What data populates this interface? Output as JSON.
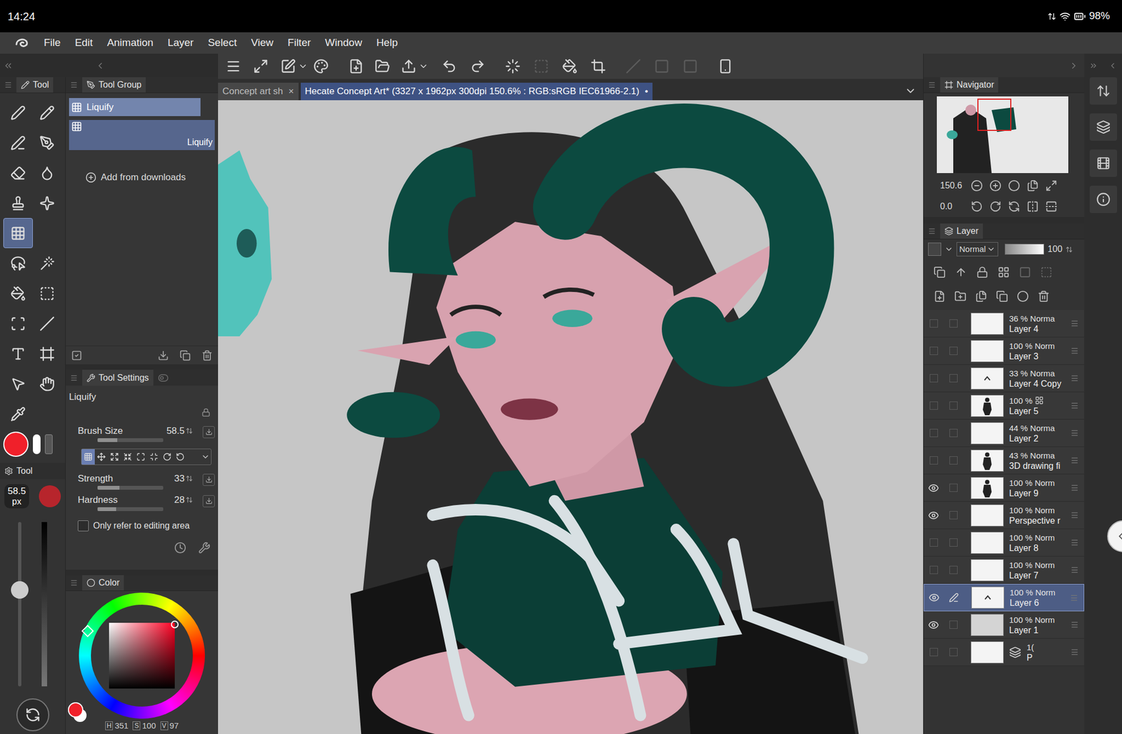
{
  "status_bar": {
    "time": "14:24",
    "battery": "98%"
  },
  "menu": [
    "File",
    "Edit",
    "Animation",
    "Layer",
    "Select",
    "View",
    "Filter",
    "Window",
    "Help"
  ],
  "toolbar": [
    {
      "disabled": false
    },
    {
      "disabled": false
    },
    {
      "disabled": false
    },
    {
      "disabled": false
    },
    {
      "disabled": false
    },
    {
      "disabled": false
    },
    {
      "disabled": false
    },
    {
      "disabled": false
    },
    {
      "disabled": false
    },
    {
      "disabled": false
    },
    {
      "disabled": false
    },
    {
      "disabled": false
    },
    {
      "disabled": true
    },
    {
      "disabled": false
    },
    {
      "disabled": false
    },
    {
      "disabled": true
    },
    {
      "disabled": true
    },
    {
      "disabled": true
    },
    {
      "disabled": false
    }
  ],
  "tabs": [
    {
      "label": "Concept art sh",
      "close": "×",
      "selected": false
    },
    {
      "label": "Hecate Concept Art* (3327 x 1962px 300dpi 150.6% : RGB:sRGB IEC61966-2.1)",
      "close": "•",
      "selected": true
    }
  ],
  "tool_panel": {
    "title": "Tool",
    "tools": [
      {
        "selected": false
      },
      {
        "selected": false
      },
      {
        "selected": false
      },
      {
        "selected": false
      },
      {
        "selected": false
      },
      {
        "selected": false
      },
      {
        "selected": false
      },
      {
        "selected": false
      },
      {
        "selected": true
      },
      {
        "selected": false
      },
      {
        "selected": false
      },
      {
        "selected": false
      },
      {
        "selected": false
      },
      {
        "selected": false
      },
      {
        "selected": false
      },
      {
        "selected": false
      },
      {
        "selected": false
      },
      {
        "selected": false
      },
      {
        "selected": false
      },
      {
        "selected": false
      }
    ],
    "main_color": "#f0202a",
    "sub_title": "Tool",
    "size": "58.5",
    "unit": "px",
    "size_level": 0.64,
    "opacity_level": 1
  },
  "tool_group": {
    "title": "Tool Group",
    "items": [
      {
        "kind": "group",
        "label": "Liquify",
        "selected": true
      },
      {
        "kind": "subtool",
        "label": "Liquify",
        "selected": true
      }
    ],
    "add": "Add from downloads"
  },
  "tool_settings": {
    "title": "Tool Settings",
    "tool": "Liquify",
    "sliders": [
      {
        "label": "Brush Size",
        "value": "58.5",
        "level": 0.3
      },
      {
        "label": "Strength",
        "value": "33",
        "level": 0.33
      },
      {
        "label": "Hardness",
        "value": "28",
        "level": 0.28
      }
    ],
    "modes": [
      {
        "selected": true
      },
      {
        "selected": false
      },
      {
        "selected": false
      },
      {
        "selected": false
      },
      {
        "selected": false
      },
      {
        "selected": false
      },
      {
        "selected": false
      },
      {
        "selected": false
      }
    ],
    "option": {
      "label": "Only refer to editing area",
      "checked": false
    }
  },
  "color_panel": {
    "title": "Color",
    "readings": [
      {
        "label": "H",
        "value": "351"
      },
      {
        "label": "S",
        "value": "100"
      },
      {
        "label": "V",
        "value": "97"
      }
    ]
  },
  "navigator": {
    "title": "Navigator",
    "zoom": "150.6",
    "rotation": "0.0"
  },
  "layer_panel": {
    "title": "Layer",
    "blend": "Normal",
    "opacity": "100",
    "opacity_level": 1,
    "layers": [
      {
        "info": "36 % Norma",
        "name": "Layer 4",
        "visible": false,
        "editing": false,
        "selected": false,
        "thumb": "empty",
        "mask": false
      },
      {
        "info": "100 % Norm",
        "name": "Layer 3",
        "visible": false,
        "editing": false,
        "selected": false,
        "thumb": "empty",
        "mask": false
      },
      {
        "info": "33 % Norma",
        "name": "Layer 4 Copy",
        "visible": false,
        "editing": false,
        "selected": false,
        "thumb": "mark",
        "mask": false
      },
      {
        "info": "100 %",
        "name": "Layer 5",
        "visible": false,
        "editing": false,
        "selected": false,
        "thumb": "figure",
        "mask": true
      },
      {
        "info": "44 % Norma",
        "name": "Layer 2",
        "visible": false,
        "editing": false,
        "selected": false,
        "thumb": "empty",
        "mask": false
      },
      {
        "info": "43 % Norma",
        "name": "3D drawing fi",
        "visible": false,
        "editing": false,
        "selected": false,
        "thumb": "figure",
        "mask": false
      },
      {
        "info": "100 % Norm",
        "name": "Layer 9",
        "visible": true,
        "editing": false,
        "selected": false,
        "thumb": "figure",
        "mask": false
      },
      {
        "info": "100 % Norm",
        "name": "Perspective r",
        "visible": true,
        "editing": false,
        "selected": false,
        "thumb": "empty",
        "mask": false
      },
      {
        "info": "100 % Norm",
        "name": "Layer 8",
        "visible": false,
        "editing": false,
        "selected": false,
        "thumb": "empty",
        "mask": false
      },
      {
        "info": "100 % Norm",
        "name": "Layer 7",
        "visible": false,
        "editing": false,
        "selected": false,
        "thumb": "empty",
        "mask": false
      },
      {
        "info": "100 % Norm",
        "name": "Layer 6",
        "visible": true,
        "editing": true,
        "selected": true,
        "thumb": "mark",
        "mask": false
      },
      {
        "info": "100 % Norm",
        "name": "Layer 1",
        "visible": true,
        "editing": false,
        "selected": false,
        "thumb": "fill",
        "mask": false
      },
      {
        "info": "1(",
        "name": "P",
        "visible": false,
        "editing": false,
        "selected": false,
        "thumb": "paper",
        "mask": false
      }
    ]
  }
}
